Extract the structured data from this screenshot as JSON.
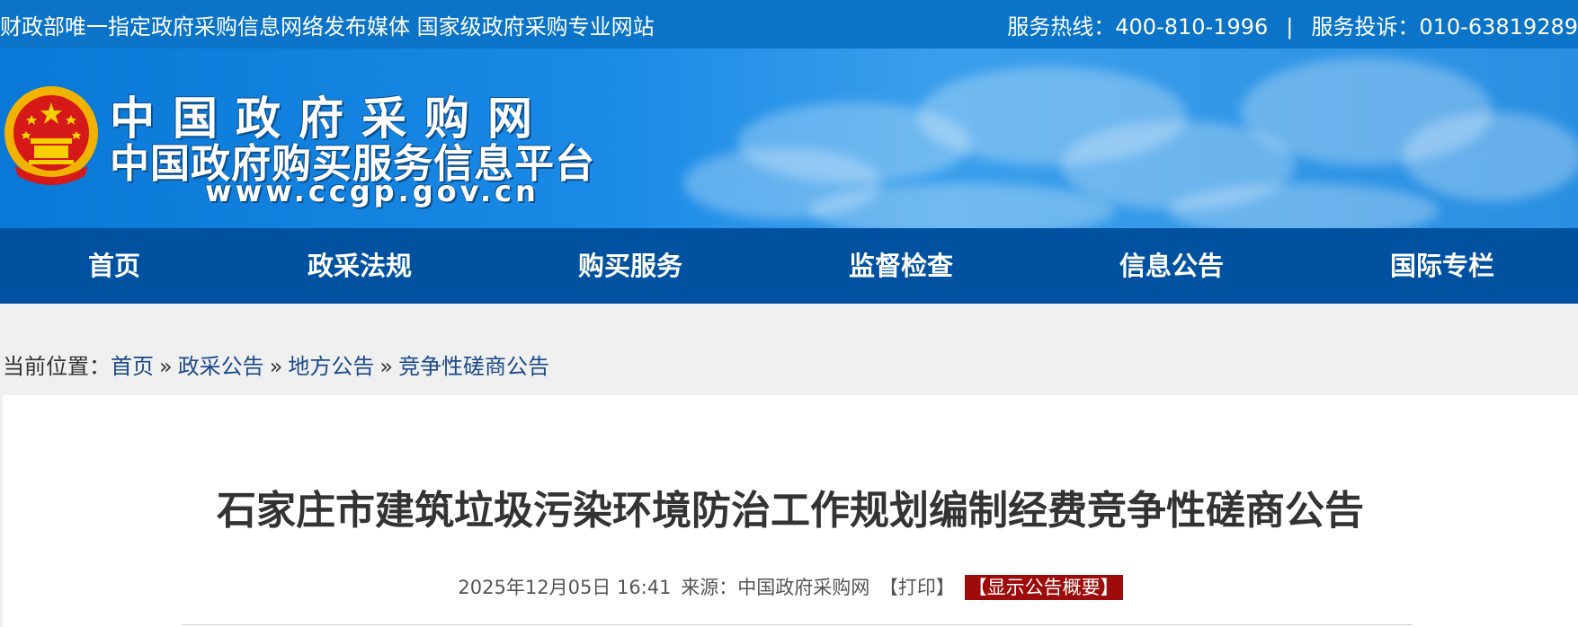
{
  "topbar": {
    "slogan": "财政部唯一指定政府采购信息网络发布媒体 国家级政府采购专业网站",
    "hotline": "服务热线：400-810-1996",
    "separator": "|",
    "complaint": "服务投诉：010-63819289"
  },
  "logo": {
    "line1": "中国政府采购网",
    "line2": "中国政府购买服务信息平台",
    "url": "www.ccgp.gov.cn"
  },
  "nav": {
    "items": [
      "首页",
      "政采法规",
      "购买服务",
      "监督检查",
      "信息公告",
      "国际专栏"
    ]
  },
  "breadcrumb": {
    "prefix": "当前位置：",
    "items": [
      "首页",
      "政采公告",
      "地方公告",
      "竞争性磋商公告"
    ],
    "separator": "»"
  },
  "article": {
    "title": "石家庄市建筑垃圾污染环境防治工作规划编制经费竞争性磋商公告",
    "datetime": "2025年12月05日 16:41",
    "source": "来源：中国政府采购网",
    "print_label": "【打印】",
    "summary_label": "【显示公告概要】"
  },
  "colors": {
    "topbar": "#0b74c8",
    "nav": "#0052a0",
    "summary_button": "#9e0b0b"
  }
}
